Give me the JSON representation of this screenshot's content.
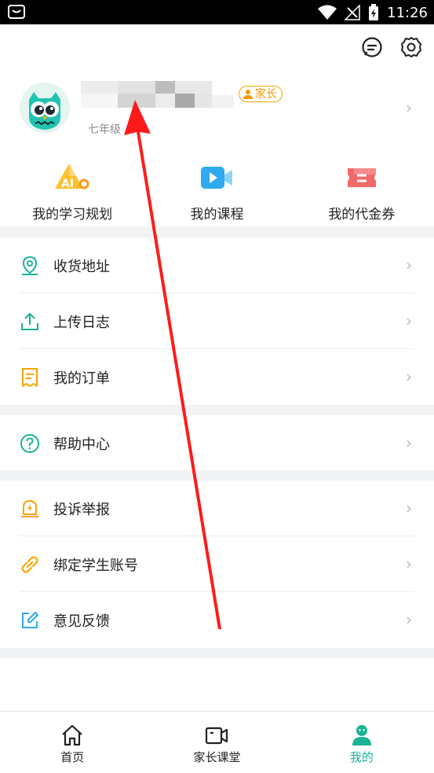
{
  "status_bar": {
    "time": "11:26"
  },
  "header": {
    "icons": [
      "message-icon",
      "settings-icon"
    ]
  },
  "profile": {
    "grade": "七年级",
    "role_badge": "家长"
  },
  "quick_actions": [
    {
      "label": "我的学习规划",
      "icon": "ai-plan-icon"
    },
    {
      "label": "我的课程",
      "icon": "video-course-icon"
    },
    {
      "label": "我的代金券",
      "icon": "voucher-icon"
    }
  ],
  "menu": {
    "group1": [
      {
        "label": "收货地址",
        "icon": "location-icon"
      },
      {
        "label": "上传日志",
        "icon": "upload-icon"
      },
      {
        "label": "我的订单",
        "icon": "order-icon"
      }
    ],
    "group2": [
      {
        "label": "帮助中心",
        "icon": "help-icon"
      }
    ],
    "group3": [
      {
        "label": "投诉举报",
        "icon": "report-icon"
      },
      {
        "label": "绑定学生账号",
        "icon": "link-icon"
      },
      {
        "label": "意见反馈",
        "icon": "feedback-icon"
      }
    ]
  },
  "bottom_nav": [
    {
      "label": "首页",
      "icon": "home-icon"
    },
    {
      "label": "家长课堂",
      "icon": "parent-class-icon"
    },
    {
      "label": "我的",
      "icon": "profile-icon",
      "active": true
    }
  ],
  "colors": {
    "accent": "#1ab394",
    "badge": "#f4a600",
    "arrow": "#ff1a1a"
  }
}
